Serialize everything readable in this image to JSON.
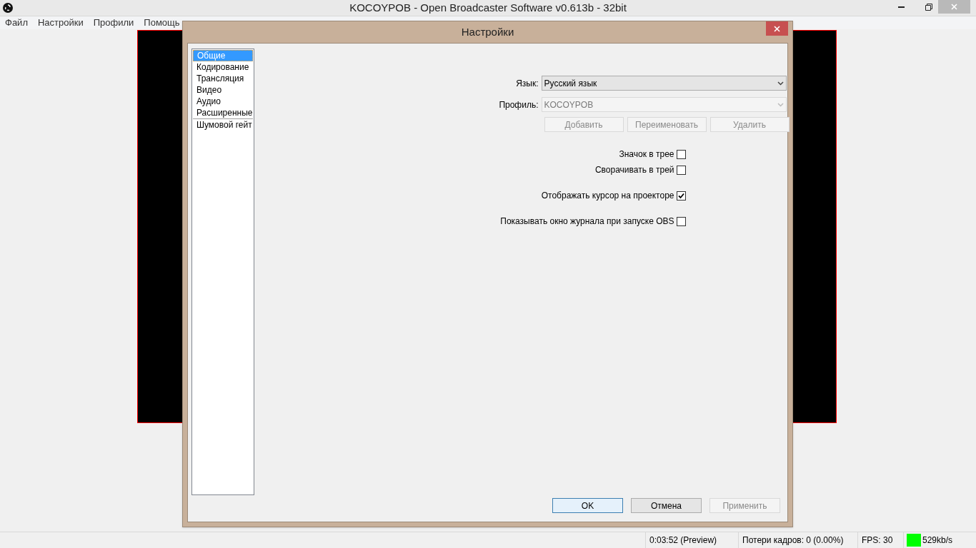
{
  "window": {
    "title": "KOCOYPOB - Open Broadcaster Software v0.613b - 32bit"
  },
  "menu": [
    "Файл",
    "Настройки",
    "Профили",
    "Помощь"
  ],
  "dialog": {
    "title": "Настройки",
    "sidebar": {
      "groups": [
        {
          "items": [
            {
              "label": "Общие",
              "selected": true
            },
            {
              "label": "Кодирование",
              "selected": false
            },
            {
              "label": "Трансляция",
              "selected": false
            },
            {
              "label": "Видео",
              "selected": false
            },
            {
              "label": "Аудио",
              "selected": false
            },
            {
              "label": "Расширенные",
              "selected": false
            }
          ]
        },
        {
          "items": [
            {
              "label": "Шумовой гейт",
              "selected": false
            }
          ]
        }
      ]
    },
    "fields": [
      {
        "label": "Язык:",
        "value": "Русский язык",
        "disabled": false
      },
      {
        "label": "Профиль:",
        "value": "KOCOYPOB",
        "disabled": true
      }
    ],
    "profile_buttons": [
      {
        "label": "Добавить",
        "disabled": true
      },
      {
        "label": "Переименовать",
        "disabled": true
      },
      {
        "label": "Удалить",
        "disabled": true
      }
    ],
    "checkbox_groups": [
      [
        {
          "label": "Значок в трее",
          "checked": false
        },
        {
          "label": "Сворачивать в трей",
          "checked": false
        }
      ],
      [
        {
          "label": "Отображать курсор на проекторе",
          "checked": true
        }
      ],
      [
        {
          "label": "Показывать окно журнала при запуске OBS",
          "checked": false
        }
      ]
    ],
    "buttons": [
      {
        "label": "OK",
        "default": true,
        "disabled": false
      },
      {
        "label": "Отмена",
        "default": false,
        "disabled": false
      },
      {
        "label": "Применить",
        "default": false,
        "disabled": true
      }
    ]
  },
  "status_bar": {
    "time": "0:03:52 (Preview)",
    "dropped": "Потери кадров: 0 (0.00%)",
    "fps": "FPS: 30",
    "bitrate": "529kb/s",
    "indicator": {
      "color": "#00ff00"
    }
  }
}
